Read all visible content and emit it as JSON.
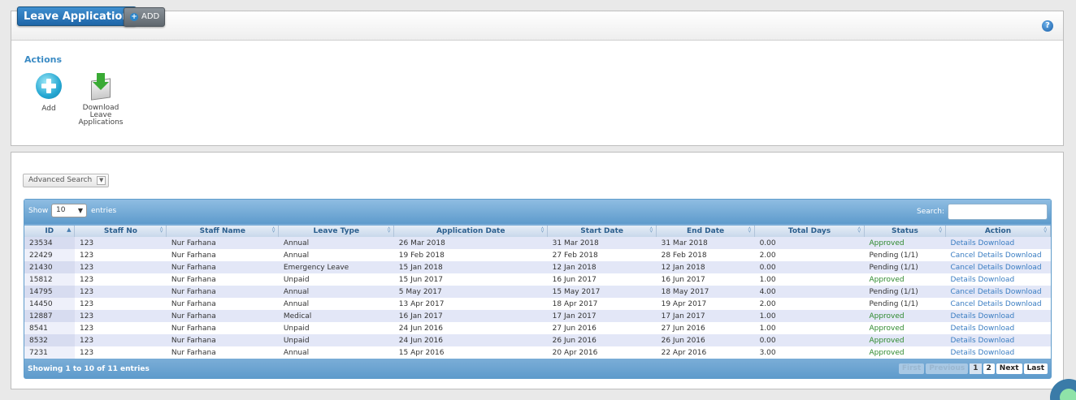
{
  "header": {
    "title": "Leave Application",
    "add_label": "ADD",
    "help": "?"
  },
  "actions": {
    "title": "Actions",
    "add_label": "Add",
    "download_label_1": "Download",
    "download_label_2": "Leave",
    "download_label_3": "Applications"
  },
  "search": {
    "advanced_label": "Advanced Search",
    "show_label": "Show",
    "entries_value": "10",
    "entries_label": "entries",
    "search_label": "Search:",
    "search_value": ""
  },
  "table": {
    "columns": [
      "ID",
      "Staff No",
      "Staff Name",
      "Leave Type",
      "Application Date",
      "Start Date",
      "End Date",
      "Total Days",
      "Status",
      "Action"
    ],
    "rows": [
      {
        "id": "23534",
        "staff_no": "123",
        "name": "Nur Farhana",
        "type": "Annual",
        "app_date": "26 Mar 2018",
        "start": "31 Mar 2018",
        "end": "31 Mar 2018",
        "days": "0.00",
        "status": "Approved",
        "cancel": "",
        "details": "Details",
        "download": "Download"
      },
      {
        "id": "22429",
        "staff_no": "123",
        "name": "Nur Farhana",
        "type": "Annual",
        "app_date": "19 Feb 2018",
        "start": "27 Feb 2018",
        "end": "28 Feb 2018",
        "days": "2.00",
        "status": "Pending (1/1)",
        "cancel": "Cancel",
        "details": "Details",
        "download": "Download"
      },
      {
        "id": "21430",
        "staff_no": "123",
        "name": "Nur Farhana",
        "type": "Emergency Leave",
        "app_date": "15 Jan 2018",
        "start": "12 Jan 2018",
        "end": "12 Jan 2018",
        "days": "0.00",
        "status": "Pending (1/1)",
        "cancel": "Cancel",
        "details": "Details",
        "download": "Download"
      },
      {
        "id": "15812",
        "staff_no": "123",
        "name": "Nur Farhana",
        "type": "Unpaid",
        "app_date": "15 Jun 2017",
        "start": "16 Jun 2017",
        "end": "16 Jun 2017",
        "days": "1.00",
        "status": "Approved",
        "cancel": "",
        "details": "Details",
        "download": "Download"
      },
      {
        "id": "14795",
        "staff_no": "123",
        "name": "Nur Farhana",
        "type": "Annual",
        "app_date": "5 May 2017",
        "start": "15 May 2017",
        "end": "18 May 2017",
        "days": "4.00",
        "status": "Pending (1/1)",
        "cancel": "Cancel",
        "details": "Details",
        "download": "Download"
      },
      {
        "id": "14450",
        "staff_no": "123",
        "name": "Nur Farhana",
        "type": "Annual",
        "app_date": "13 Apr 2017",
        "start": "18 Apr 2017",
        "end": "19 Apr 2017",
        "days": "2.00",
        "status": "Pending (1/1)",
        "cancel": "Cancel",
        "details": "Details",
        "download": "Download"
      },
      {
        "id": "12887",
        "staff_no": "123",
        "name": "Nur Farhana",
        "type": "Medical",
        "app_date": "16 Jan 2017",
        "start": "17 Jan 2017",
        "end": "17 Jan 2017",
        "days": "1.00",
        "status": "Approved",
        "cancel": "",
        "details": "Details",
        "download": "Download"
      },
      {
        "id": "8541",
        "staff_no": "123",
        "name": "Nur Farhana",
        "type": "Unpaid",
        "app_date": "24 Jun 2016",
        "start": "27 Jun 2016",
        "end": "27 Jun 2016",
        "days": "1.00",
        "status": "Approved",
        "cancel": "",
        "details": "Details",
        "download": "Download"
      },
      {
        "id": "8532",
        "staff_no": "123",
        "name": "Nur Farhana",
        "type": "Unpaid",
        "app_date": "24 Jun 2016",
        "start": "26 Jun 2016",
        "end": "26 Jun 2016",
        "days": "0.00",
        "status": "Approved",
        "cancel": "",
        "details": "Details",
        "download": "Download"
      },
      {
        "id": "7231",
        "staff_no": "123",
        "name": "Nur Farhana",
        "type": "Annual",
        "app_date": "15 Apr 2016",
        "start": "20 Apr 2016",
        "end": "22 Apr 2016",
        "days": "3.00",
        "status": "Approved",
        "cancel": "",
        "details": "Details",
        "download": "Download"
      }
    ]
  },
  "footer": {
    "info": "Showing 1 to 10 of 11 entries",
    "first": "First",
    "previous": "Previous",
    "page1": "1",
    "page2": "2",
    "next": "Next",
    "last": "Last"
  },
  "colors": {
    "approved": "#2f8a2f",
    "link": "#3a7dc2",
    "header_blue": "#1f66a8"
  }
}
